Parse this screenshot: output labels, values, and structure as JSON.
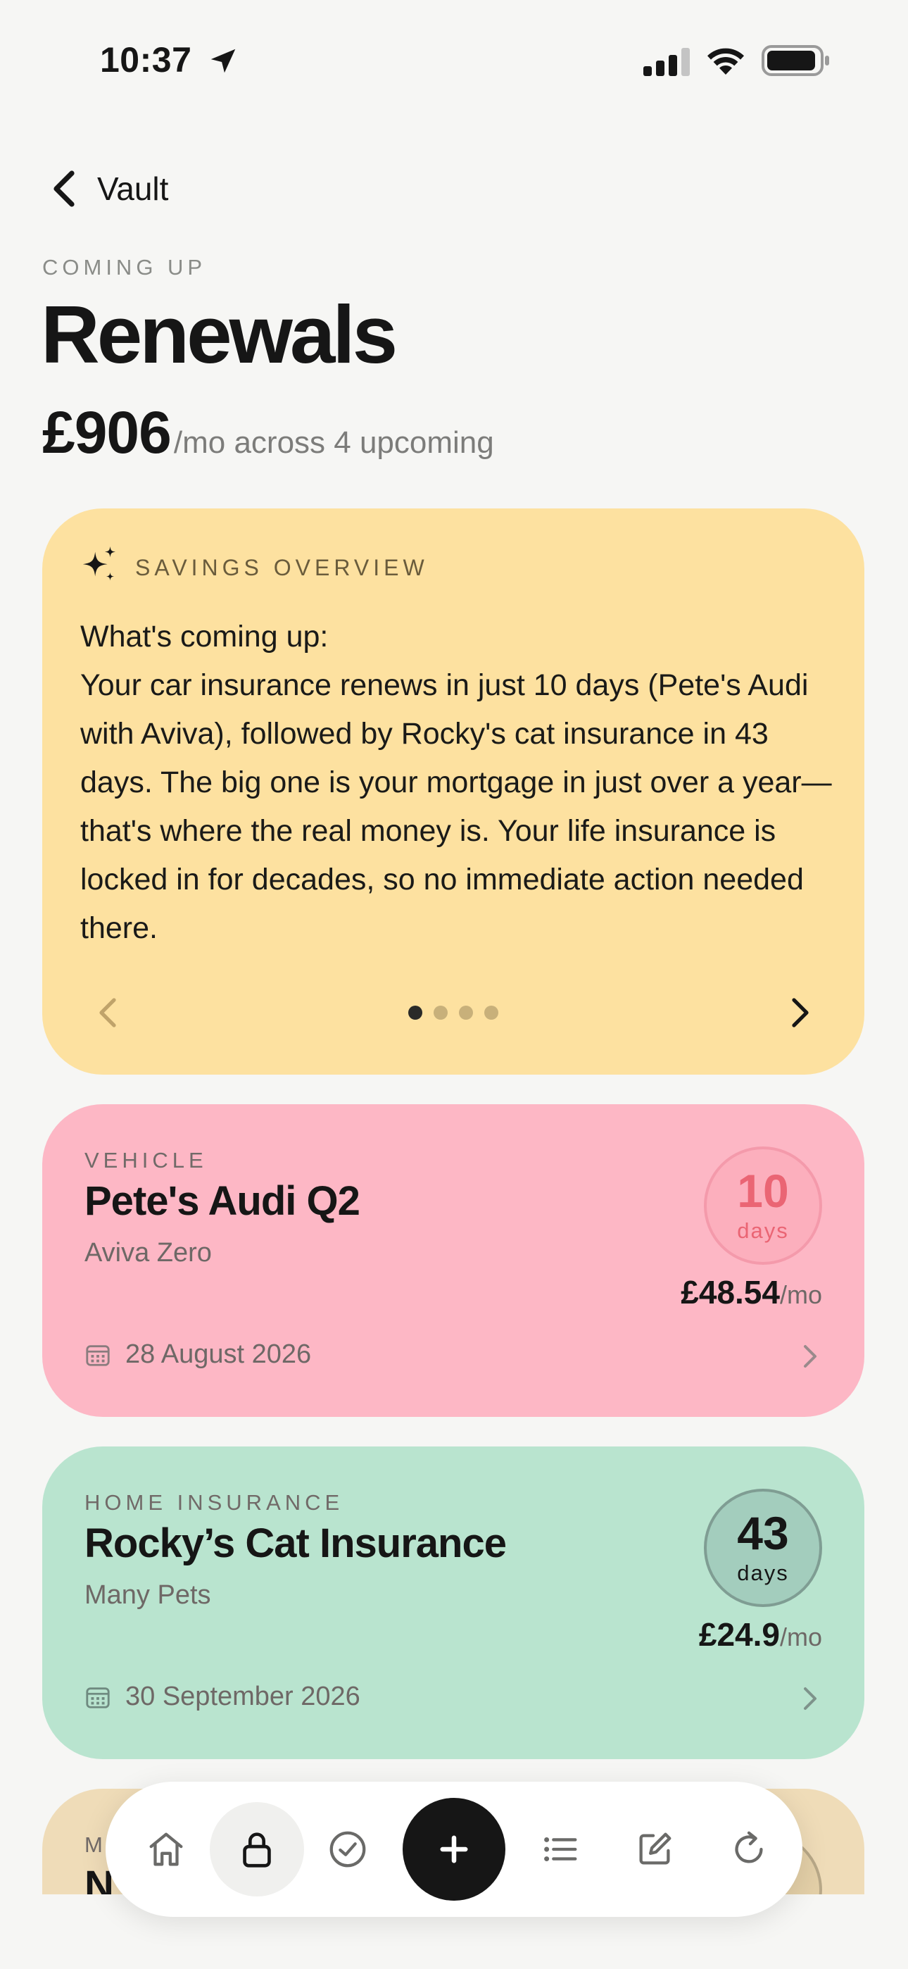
{
  "status_bar": {
    "time": "10:37"
  },
  "header": {
    "back_label": "Vault",
    "eyebrow": "COMING UP",
    "title": "Renewals",
    "total_amount": "£906",
    "total_suffix": "/mo across 4 upcoming"
  },
  "savings": {
    "label": "SAVINGS OVERVIEW",
    "heading": "What's coming up:",
    "body": "Your car insurance renews in just 10 days (Pete's Audi with Aviva), followed by Rocky's cat insurance in 43 days. The big one is your mortgage in just over a year—that's where the real money is. Your life insurance is locked in for decades, so no immediate action needed there.",
    "page_count": 4,
    "active_page": 1
  },
  "renewals": [
    {
      "category": "VEHICLE",
      "title": "Pete's Audi Q2",
      "provider": "Aviva Zero",
      "days": "10",
      "days_label": "days",
      "price": "£48.54",
      "per": "/mo",
      "date": "28 August 2026",
      "color": "#fdb7c5"
    },
    {
      "category": "HOME INSURANCE",
      "title": "Rocky’s Cat Insurance",
      "provider": "Many Pets",
      "days": "43",
      "days_label": "days",
      "price": "£24.9",
      "per": "/mo",
      "date": "30 September 2026",
      "color": "#b9e4cf"
    },
    {
      "category": "M",
      "title": "N",
      "color": "#efdcb8"
    }
  ],
  "tab_bar": {
    "items": [
      "home-icon",
      "lock-icon",
      "check-circle-icon",
      "plus-icon",
      "list-icon",
      "edit-icon",
      "refresh-icon"
    ]
  }
}
